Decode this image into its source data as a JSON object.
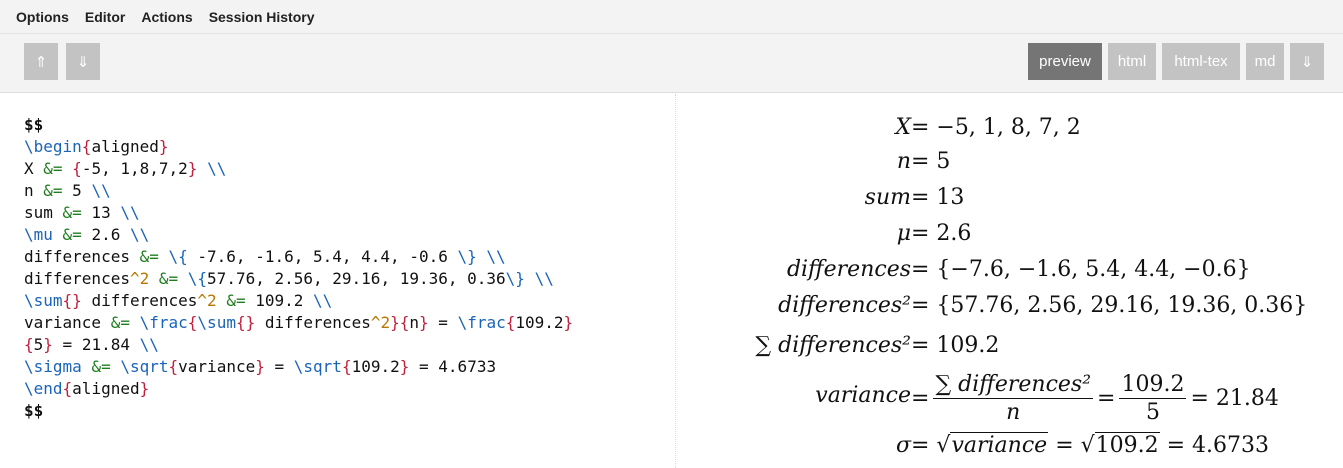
{
  "menu": {
    "items": [
      "Options",
      "Editor",
      "Actions",
      "Session History"
    ]
  },
  "toolbar": {
    "move_up_icon": "⇑",
    "move_down_icon": "⇓",
    "tabs": [
      "preview",
      "html",
      "html-tex",
      "md"
    ],
    "active_tab": "preview",
    "download_icon": "⇓"
  },
  "editor": {
    "lines": [
      "$$",
      "\\begin{aligned}",
      "X &= {-5, 1,8,7,2} \\\\",
      "n &= 5 \\\\",
      "sum &= 13 \\\\",
      "\\mu &= 2.6 \\\\",
      "differences &= \\{ -7.6, -1.6, 5.4, 4.4, -0.6 \\} \\\\",
      "differences^2 &= \\{57.76, 2.56, 29.16, 19.36, 0.36\\} \\\\",
      "\\sum{} differences^2 &= 109.2 \\\\",
      "variance &= \\frac{\\sum{} differences^2}{n} = \\frac{109.2}",
      "{5} = 21.84 \\\\",
      "\\sigma &= \\sqrt{variance} = \\sqrt{109.2} = 4.6733",
      "\\end{aligned}",
      "$$"
    ]
  },
  "preview": {
    "rows": [
      {
        "lhs": "X",
        "rhs": "= −5, 1, 8, 7, 2"
      },
      {
        "lhs": "n",
        "rhs": "= 5"
      },
      {
        "lhs": "sum",
        "rhs": "= 13"
      },
      {
        "lhs": "μ",
        "rhs": "= 2.6"
      },
      {
        "lhs": "differences",
        "rhs": "= {−7.6, −1.6, 5.4, 4.4, −0.6}"
      },
      {
        "lhs": "differences²",
        "rhs": "= {57.76, 2.56, 29.16, 19.36, 0.36}"
      },
      {
        "lhs": "∑ differences²",
        "rhs": "= 109.2"
      }
    ],
    "variance": {
      "lhs": "variance",
      "eq1": "=",
      "frac1_num": "∑ differences²",
      "frac1_den": "n",
      "eq2": "=",
      "frac2_num": "109.2",
      "frac2_den": "5",
      "result": "= 21.84"
    },
    "sigma": {
      "lhs": "σ",
      "eq1": "=",
      "sqrt1": "variance",
      "eq2": "=",
      "sqrt2": "109.2",
      "result": "= 4.6733"
    }
  }
}
